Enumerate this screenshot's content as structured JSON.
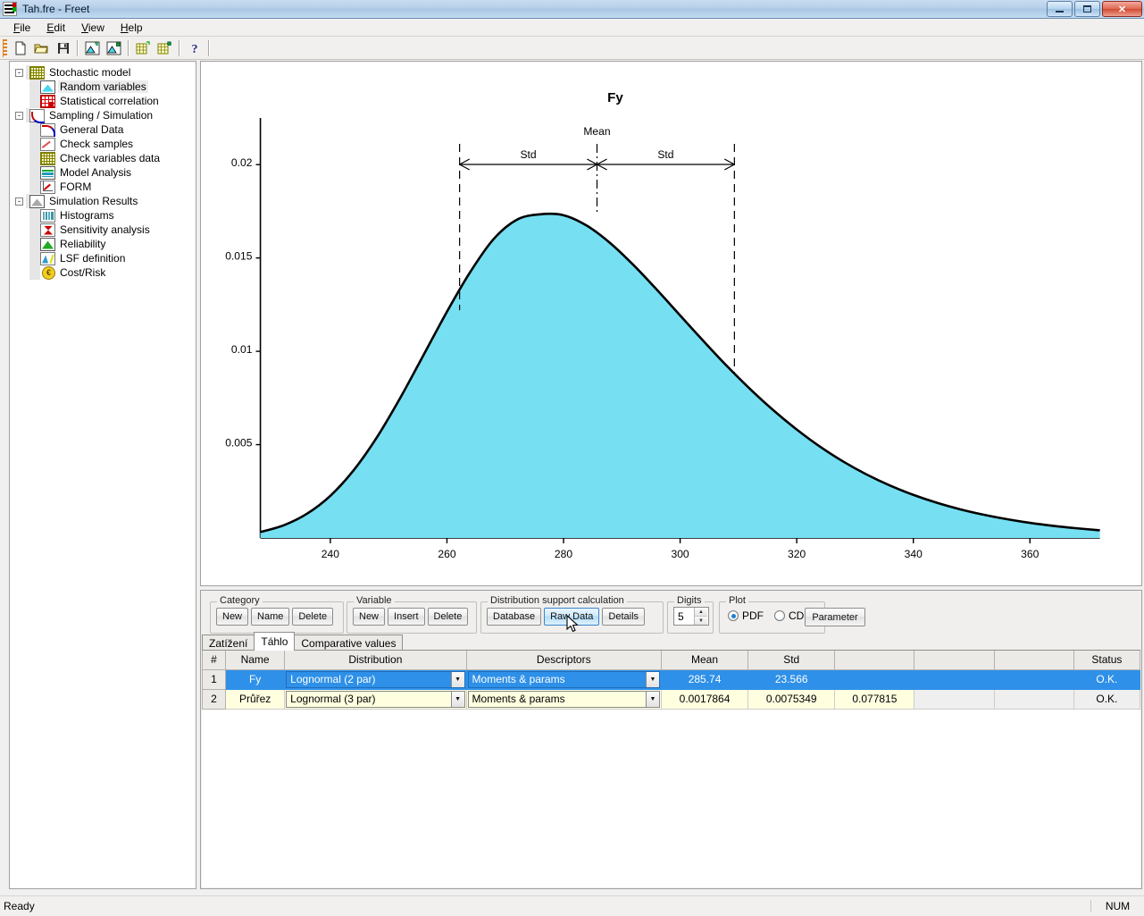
{
  "window": {
    "title": "Tah.fre - Freet",
    "minimize": "–",
    "maximize": "❐",
    "close": "✕"
  },
  "menu": [
    {
      "label": "File",
      "accel": "F"
    },
    {
      "label": "Edit",
      "accel": "E"
    },
    {
      "label": "View",
      "accel": "V"
    },
    {
      "label": "Help",
      "accel": "H"
    }
  ],
  "toolbar": [
    {
      "name": "new-file-icon",
      "tip": "New"
    },
    {
      "name": "open-file-icon",
      "tip": "Open"
    },
    {
      "name": "save-file-icon",
      "tip": "Save"
    },
    {
      "name": "random-variables-icon",
      "tip": "Random variables"
    },
    {
      "name": "random-variables-2-icon",
      "tip": "Random variables 2"
    },
    {
      "name": "grid-data-icon",
      "tip": "Data grid"
    },
    {
      "name": "grid-data-2-icon",
      "tip": "Data grid 2"
    },
    {
      "name": "help-icon",
      "tip": "Help"
    }
  ],
  "tree": [
    {
      "label": "Stochastic model",
      "level": 0,
      "icon": "ic-grid",
      "expander": "-",
      "selected": false
    },
    {
      "label": "Random variables",
      "level": 1,
      "icon": "ic-mount",
      "expander": "",
      "selected": true
    },
    {
      "label": "Statistical correlation",
      "level": 1,
      "icon": "ic-corr",
      "expander": "",
      "selected": false
    },
    {
      "label": "Sampling / Simulation",
      "level": 0,
      "icon": "ic-curve",
      "expander": "-",
      "selected": false
    },
    {
      "label": "General Data",
      "level": 1,
      "icon": "ic-gendata",
      "expander": "",
      "selected": false
    },
    {
      "label": "Check samples",
      "level": 1,
      "icon": "ic-scatter",
      "expander": "",
      "selected": false
    },
    {
      "label": "Check variables data",
      "level": 1,
      "icon": "ic-grid",
      "expander": "",
      "selected": false
    },
    {
      "label": "Model Analysis",
      "level": 1,
      "icon": "ic-model",
      "expander": "",
      "selected": false
    },
    {
      "label": "FORM",
      "level": 1,
      "icon": "ic-form",
      "expander": "",
      "selected": false
    },
    {
      "label": "Simulation Results",
      "level": 0,
      "icon": "ic-simres",
      "expander": "-",
      "selected": false
    },
    {
      "label": "Histograms",
      "level": 1,
      "icon": "ic-hist",
      "expander": "",
      "selected": false
    },
    {
      "label": "Sensitivity analysis",
      "level": 1,
      "icon": "ic-sens",
      "expander": "",
      "selected": false
    },
    {
      "label": "Reliability",
      "level": 1,
      "icon": "ic-rel",
      "expander": "",
      "selected": false
    },
    {
      "label": "LSF definition",
      "level": 1,
      "icon": "ic-lsf",
      "expander": "",
      "selected": false
    },
    {
      "label": "Cost/Risk",
      "level": 1,
      "icon": "ic-cost",
      "expander": "",
      "selected": false
    }
  ],
  "chart_data": {
    "type": "area",
    "title": "Fy",
    "xlabel": "",
    "ylabel": "",
    "xlim": [
      228,
      372
    ],
    "ylim": [
      0,
      0.0225
    ],
    "xticks": [
      240,
      260,
      280,
      300,
      320,
      340,
      360
    ],
    "yticks": [
      0.005,
      0.01,
      0.015,
      0.02
    ],
    "xtick_labels": [
      "240",
      "260",
      "280",
      "300",
      "320",
      "340",
      "360"
    ],
    "ytick_labels": [
      "0.005",
      "0.01",
      "0.015",
      "0.02"
    ],
    "grid": false,
    "legend": "none",
    "distribution": "Lognormal (2 par)",
    "mean": 285.74,
    "std": 23.566,
    "peak_y": 0.01735,
    "fill_color": "#76E0F2",
    "line_color": "#000000",
    "annotations": [
      {
        "name": "mean-label",
        "text": "Mean",
        "x": 285.74
      },
      {
        "name": "std-left-label",
        "text": "Std",
        "x": 274.0
      },
      {
        "name": "std-right-label",
        "text": "Std",
        "x": 297.5
      }
    ],
    "markers": {
      "mean_line_x": 285.74,
      "left_std_line_x": 262.17,
      "right_std_line_x": 309.31
    },
    "series": [
      {
        "name": "PDF",
        "x": [
          228,
          232,
          236,
          240,
          244,
          248,
          252,
          256,
          260,
          264,
          268,
          272,
          276,
          280,
          284,
          288,
          292,
          296,
          300,
          304,
          308,
          312,
          316,
          320,
          324,
          328,
          332,
          336,
          340,
          344,
          348,
          352,
          356,
          360,
          364,
          368,
          372
        ],
        "y": [
          0.00032,
          0.00068,
          0.0013,
          0.00226,
          0.00363,
          0.0054,
          0.00751,
          0.00981,
          0.01212,
          0.01425,
          0.01601,
          0.01705,
          0.01734,
          0.01729,
          0.01673,
          0.0158,
          0.01462,
          0.0133,
          0.01192,
          0.01055,
          0.00922,
          0.00798,
          0.00684,
          0.00581,
          0.00489,
          0.00409,
          0.0034,
          0.00281,
          0.00231,
          0.00189,
          0.00154,
          0.00125,
          0.00101,
          0.00081,
          0.00065,
          0.00052,
          0.00041
        ]
      }
    ]
  },
  "panel": {
    "category": {
      "title": "Category",
      "buttons": [
        "New",
        "Name",
        "Delete"
      ]
    },
    "variable": {
      "title": "Variable",
      "buttons": [
        "New",
        "Insert",
        "Delete"
      ]
    },
    "support": {
      "title": "Distribution support calculation",
      "buttons": [
        "Database",
        "Raw Data",
        "Details"
      ],
      "hovered": "Raw Data"
    },
    "digits": {
      "title": "Digits",
      "value": "5"
    },
    "plot": {
      "title": "Plot",
      "options": [
        {
          "label": "PDF",
          "selected": true
        },
        {
          "label": "CDF",
          "selected": false
        }
      ]
    },
    "parameter_button": "Parameter"
  },
  "tabs": [
    {
      "label": "Zatížení",
      "active": false
    },
    {
      "label": "Táhlo",
      "active": true
    },
    {
      "label": "Comparative values",
      "active": false
    }
  ],
  "table": {
    "headers": [
      "#",
      "Name",
      "Distribution",
      "Descriptors",
      "Mean",
      "Std",
      "",
      "",
      "",
      "Status"
    ],
    "rows": [
      {
        "selected": true,
        "index": "1",
        "name": "Fy",
        "distribution": "Lognormal (2 par)",
        "descriptors": "Moments & params",
        "mean": "285.74",
        "std": "23.566",
        "c3": "",
        "c4": "",
        "c5": "",
        "status": "O.K."
      },
      {
        "selected": false,
        "index": "2",
        "name": "Průřez",
        "distribution": "Lognormal (3 par)",
        "descriptors": "Moments & params",
        "mean": "0.0017864",
        "std": "0.0075349",
        "c3": "0.077815",
        "c4": "",
        "c5": "",
        "status": "O.K."
      }
    ]
  },
  "statusbar": {
    "message": "Ready",
    "num": "NUM"
  },
  "colors": {
    "selection": "#2e90e8",
    "chart_fill": "#76E0F2",
    "alt_row": "#ffffe0",
    "status_alt": "#d98600"
  }
}
